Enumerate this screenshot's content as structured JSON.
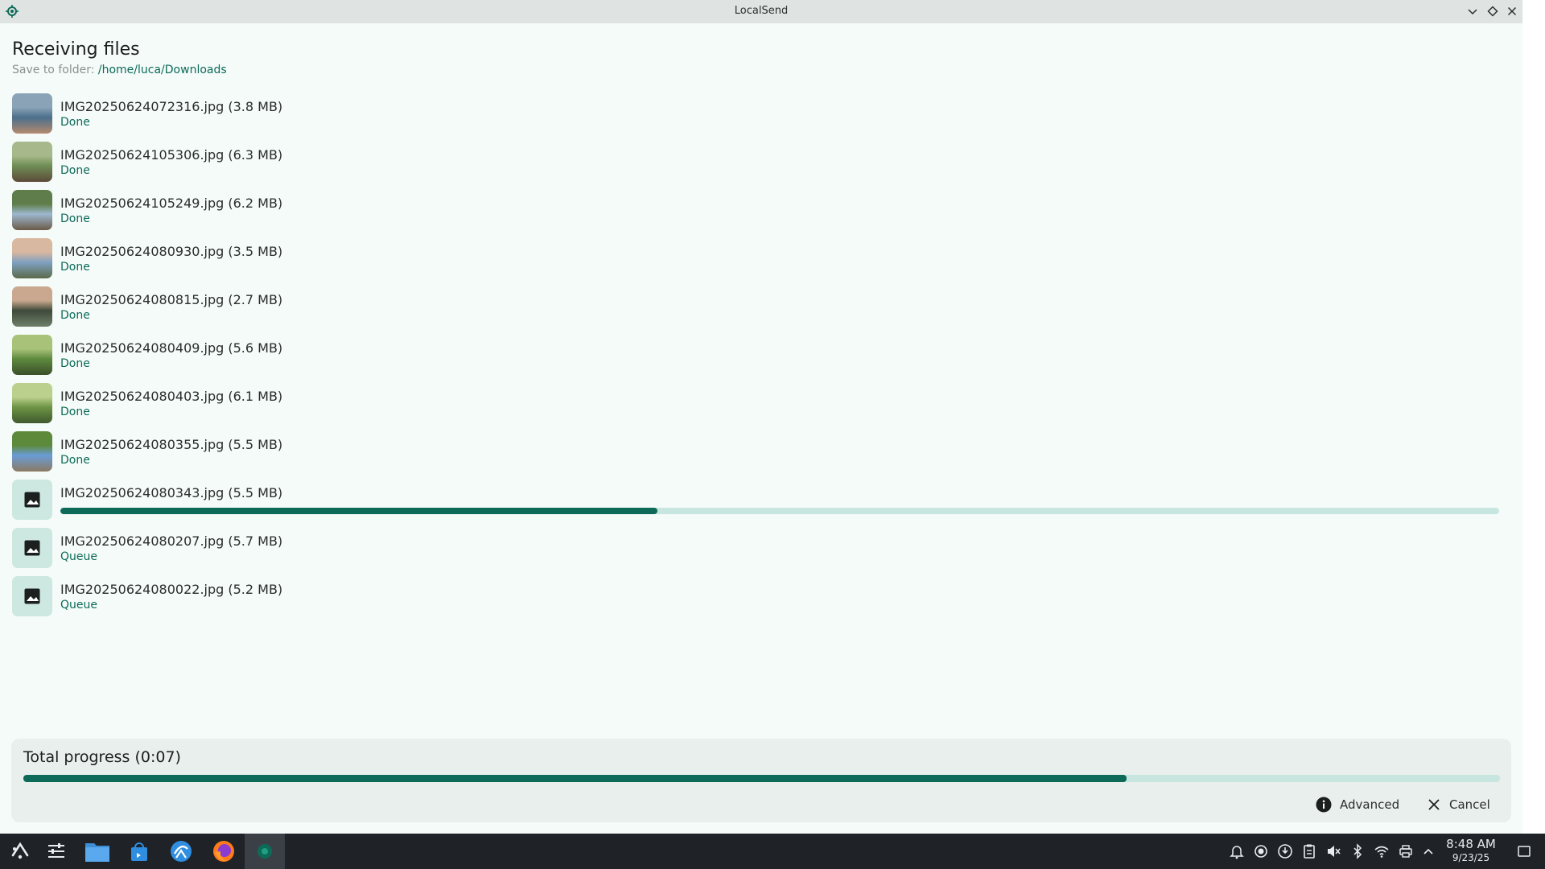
{
  "window": {
    "title": "LocalSend"
  },
  "header": {
    "title": "Receiving files",
    "save_label": "Save to folder:",
    "save_path": "/home/luca/Downloads"
  },
  "files": [
    {
      "name": "IMG20250624072316.jpg (3.8 MB)",
      "status": "Done",
      "thumb": "photo",
      "palette": [
        "#4b6f8c",
        "#8aa3b6",
        "#b58a6e"
      ]
    },
    {
      "name": "IMG20250624105306.jpg (6.3 MB)",
      "status": "Done",
      "thumb": "photo",
      "palette": [
        "#6f8e55",
        "#a7b98a",
        "#5c4a3a"
      ]
    },
    {
      "name": "IMG20250624105249.jpg (6.2 MB)",
      "status": "Done",
      "thumb": "photo",
      "palette": [
        "#9db8cf",
        "#5f7d4a",
        "#6b5a48"
      ]
    },
    {
      "name": "IMG20250624080930.jpg (3.5 MB)",
      "status": "Done",
      "thumb": "photo",
      "palette": [
        "#7fa0c0",
        "#d8b8a0",
        "#5a6a4a"
      ]
    },
    {
      "name": "IMG20250624080815.jpg (2.7 MB)",
      "status": "Done",
      "thumb": "photo",
      "palette": [
        "#3f4a3a",
        "#c9a88f",
        "#6e7f6a"
      ]
    },
    {
      "name": "IMG20250624080409.jpg (5.6 MB)",
      "status": "Done",
      "thumb": "photo",
      "palette": [
        "#5e8a3e",
        "#a9c27a",
        "#3a4f2a"
      ]
    },
    {
      "name": "IMG20250624080403.jpg (6.1 MB)",
      "status": "Done",
      "thumb": "photo",
      "palette": [
        "#6d9445",
        "#bcd08d",
        "#40592d"
      ]
    },
    {
      "name": "IMG20250624080355.jpg (5.5 MB)",
      "status": "Done",
      "thumb": "photo",
      "palette": [
        "#6a9cd6",
        "#5d8a3a",
        "#8b7a62"
      ]
    },
    {
      "name": "IMG20250624080343.jpg (5.5 MB)",
      "status": "",
      "thumb": "placeholder",
      "progress": 0.415
    },
    {
      "name": "IMG20250624080207.jpg (5.7 MB)",
      "status": "Queue",
      "thumb": "placeholder"
    },
    {
      "name": "IMG20250624080022.jpg (5.2 MB)",
      "status": "Queue",
      "thumb": "placeholder"
    }
  ],
  "total": {
    "label": "Total progress (0:07)",
    "progress": 0.747
  },
  "actions": {
    "advanced_label": "Advanced",
    "cancel_label": "Cancel"
  },
  "taskbar": {
    "apps": [
      {
        "name": "application-launcher-icon",
        "active": false
      },
      {
        "name": "system-settings-icon",
        "active": false
      },
      {
        "name": "file-manager-icon",
        "active": false
      },
      {
        "name": "software-store-icon",
        "active": false
      },
      {
        "name": "web-browser-icon",
        "active": false
      },
      {
        "name": "firefox-icon",
        "active": false
      },
      {
        "name": "localsend-icon",
        "active": true
      }
    ],
    "tray": [
      "notifications-icon",
      "app-indicator-icon",
      "updates-icon",
      "clipboard-icon",
      "volume-muted-icon",
      "bluetooth-icon",
      "wifi-icon",
      "printer-icon",
      "tray-expand-icon"
    ],
    "clock_time": "8:48 AM",
    "clock_date": "9/23/25"
  },
  "colors": {
    "accent": "#0d6a58",
    "track": "#c7e6df",
    "background": "#f4fbf9"
  }
}
